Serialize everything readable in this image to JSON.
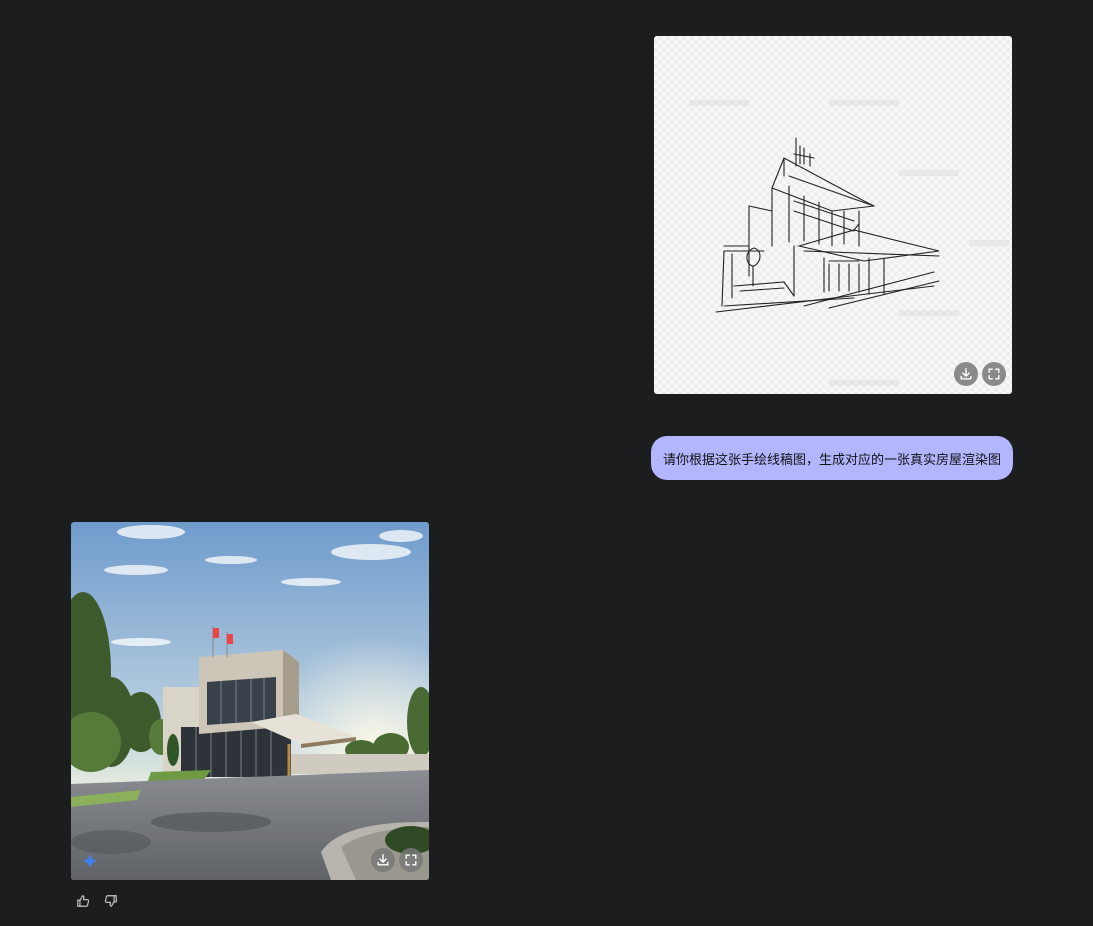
{
  "user_message": {
    "text": "请你根据这张手绘线稿图，生成对应的一张真实房屋渲染图"
  },
  "colors": {
    "background": "#1c1d1f",
    "user_bubble": "#b3b6ff",
    "icon_button": "#787878",
    "sparkle_accent": "#3b82f6"
  },
  "icons": {
    "download": "download-icon",
    "fullscreen": "fullscreen-icon",
    "thumbs_up": "thumbs-up-icon",
    "thumbs_down": "thumbs-down-icon",
    "ai_badge": "sparkle-icon"
  }
}
